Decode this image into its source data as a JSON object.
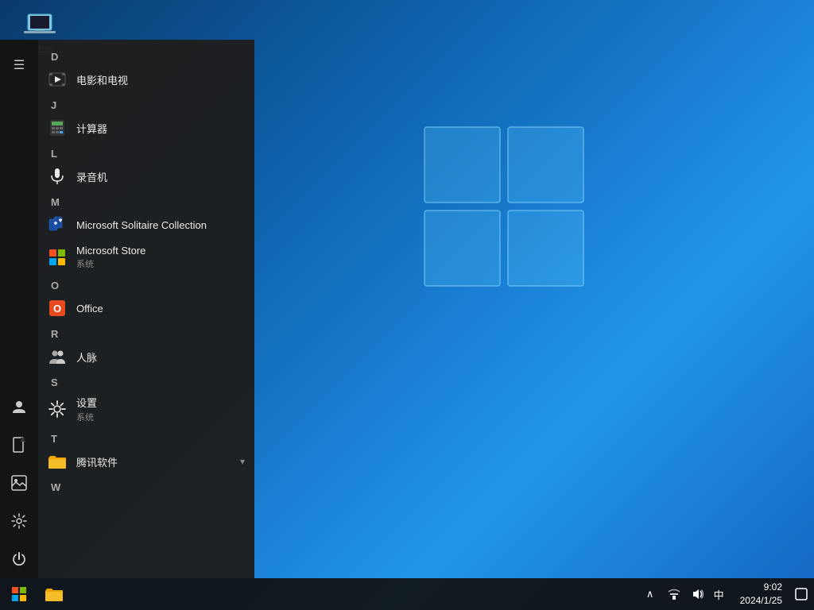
{
  "desktop": {
    "icon_label": "此电脑"
  },
  "start_menu": {
    "hamburger_label": "☰",
    "sections": [
      {
        "letter": "D",
        "apps": [
          {
            "name": "电影和电视",
            "subtitle": "",
            "icon": "film"
          }
        ]
      },
      {
        "letter": "J",
        "apps": [
          {
            "name": "计算器",
            "subtitle": "",
            "icon": "calc"
          }
        ]
      },
      {
        "letter": "L",
        "apps": [
          {
            "name": "录音机",
            "subtitle": "",
            "icon": "mic"
          }
        ]
      },
      {
        "letter": "M",
        "apps": [
          {
            "name": "Microsoft Solitaire Collection",
            "subtitle": "",
            "icon": "cards"
          },
          {
            "name": "Microsoft Store",
            "subtitle": "系统",
            "icon": "store"
          }
        ]
      },
      {
        "letter": "O",
        "apps": [
          {
            "name": "Office",
            "subtitle": "",
            "icon": "office"
          }
        ]
      },
      {
        "letter": "R",
        "apps": [
          {
            "name": "人脉",
            "subtitle": "",
            "icon": "people"
          }
        ]
      },
      {
        "letter": "S",
        "apps": [
          {
            "name": "设置",
            "subtitle": "系统",
            "icon": "settings"
          }
        ]
      },
      {
        "letter": "T",
        "apps": [
          {
            "name": "腾讯软件",
            "subtitle": "",
            "icon": "folder",
            "expandable": true
          }
        ]
      },
      {
        "letter": "W",
        "apps": []
      }
    ]
  },
  "sidebar": {
    "items": [
      {
        "name": "user-icon",
        "symbol": "👤"
      },
      {
        "name": "document-icon",
        "symbol": "📄"
      },
      {
        "name": "photos-icon",
        "symbol": "🖼"
      },
      {
        "name": "settings-icon",
        "symbol": "⚙"
      },
      {
        "name": "power-icon",
        "symbol": "⏻"
      }
    ]
  },
  "taskbar": {
    "start_label": "",
    "clock": {
      "time": "9:02",
      "date": "2024/1/25"
    },
    "tray": {
      "chevron": "∧",
      "network": "🌐",
      "volume": "🔊",
      "lang": "中"
    }
  }
}
